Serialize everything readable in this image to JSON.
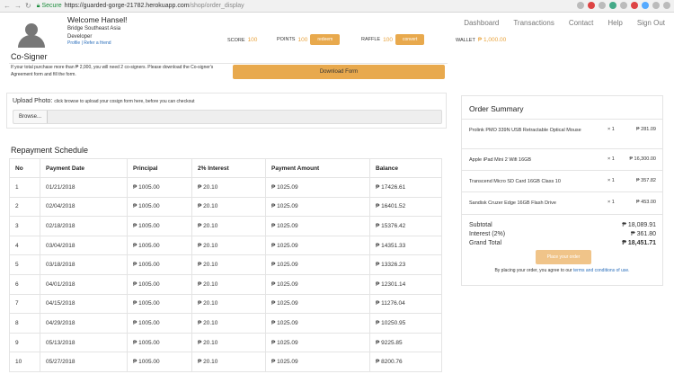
{
  "browser": {
    "secure_label": "Secure",
    "url_host": "https://guarded-gorge-21782.herokuapp.com",
    "url_path": "/shop/order_display"
  },
  "header": {
    "welcome": "Welcome Hansel!",
    "org_line1": "Bridge Southeast Asia",
    "org_line2": "Developer",
    "profile_link": "Profile",
    "separator": "|",
    "refer_link": "Refer a friend",
    "score_label": "SCORE",
    "score_value": "100",
    "points_label": "POINTS",
    "points_value": "100",
    "redeem_label": "redeem",
    "raffle_label": "RAFFLE",
    "raffle_value": "100",
    "convert_label": "convert",
    "wallet_label": "WALLET",
    "wallet_value": "₱ 1,000.00",
    "nav": [
      "Dashboard",
      "Transactions",
      "Contact",
      "Help",
      "Sign Out"
    ]
  },
  "cosigner": {
    "title": "Co-Signer",
    "note": "If your total purchase more than ₱ 2,000, you will need 2 co-signers. Please download the Co-signer's Agreement form and fill the form.",
    "download_label": "Download Form"
  },
  "upload": {
    "label": "Upload Photo:",
    "hint": "click browse to upload your cosign form here, before you can checkout",
    "browse_label": "Browse..."
  },
  "schedule": {
    "title": "Repayment Schedule",
    "headers": [
      "No",
      "Payment Date",
      "Principal",
      "2% Interest",
      "Payment Amount",
      "Balance"
    ],
    "rows": [
      [
        "1",
        "01/21/2018",
        "₱ 1005.00",
        "₱ 20.10",
        "₱ 1025.09",
        "₱ 17426.61"
      ],
      [
        "2",
        "02/04/2018",
        "₱ 1005.00",
        "₱ 20.10",
        "₱ 1025.09",
        "₱ 16401.52"
      ],
      [
        "3",
        "02/18/2018",
        "₱ 1005.00",
        "₱ 20.10",
        "₱ 1025.09",
        "₱ 15376.42"
      ],
      [
        "4",
        "03/04/2018",
        "₱ 1005.00",
        "₱ 20.10",
        "₱ 1025.09",
        "₱ 14351.33"
      ],
      [
        "5",
        "03/18/2018",
        "₱ 1005.00",
        "₱ 20.10",
        "₱ 1025.09",
        "₱ 13326.23"
      ],
      [
        "6",
        "04/01/2018",
        "₱ 1005.00",
        "₱ 20.10",
        "₱ 1025.09",
        "₱ 12301.14"
      ],
      [
        "7",
        "04/15/2018",
        "₱ 1005.00",
        "₱ 20.10",
        "₱ 1025.09",
        "₱ 11276.04"
      ],
      [
        "8",
        "04/29/2018",
        "₱ 1005.00",
        "₱ 20.10",
        "₱ 1025.09",
        "₱ 10250.95"
      ],
      [
        "9",
        "05/13/2018",
        "₱ 1005.00",
        "₱ 20.10",
        "₱ 1025.09",
        "₱ 9225.85"
      ],
      [
        "10",
        "05/27/2018",
        "₱ 1005.00",
        "₱ 20.10",
        "₱ 1025.09",
        "₱ 8200.76"
      ]
    ]
  },
  "summary": {
    "title": "Order Summary",
    "items": [
      {
        "name": "Prolink PMO 339N USB Retractable Optical Mouse",
        "qty": "× 1",
        "price": "₱ 281.09"
      },
      {
        "name": "Apple iPad Mini 2 Wifi 16GB",
        "qty": "× 1",
        "price": "₱ 16,300.00"
      },
      {
        "name": "Transcend Micro SD Card 16GB Class 10",
        "qty": "× 1",
        "price": "₱ 357.82"
      },
      {
        "name": "Sandisk Cruzer Edge 16GB Flash Drive",
        "qty": "× 1",
        "price": "₱ 453.00"
      }
    ],
    "subtotal_label": "Subtotal",
    "subtotal_value": "₱ 18,089.91",
    "interest_label": "Interest (2%)",
    "interest_value": "₱ 361.80",
    "grand_label": "Grand Total",
    "grand_value": "₱ 18,451.71",
    "place_order_label": "Place your order",
    "terms_prefix": "By placing your order, you agree to our",
    "terms_link": "terms and conditions of use."
  },
  "colors": {
    "accent": "#e8a94d",
    "link": "#2a6ebb"
  }
}
